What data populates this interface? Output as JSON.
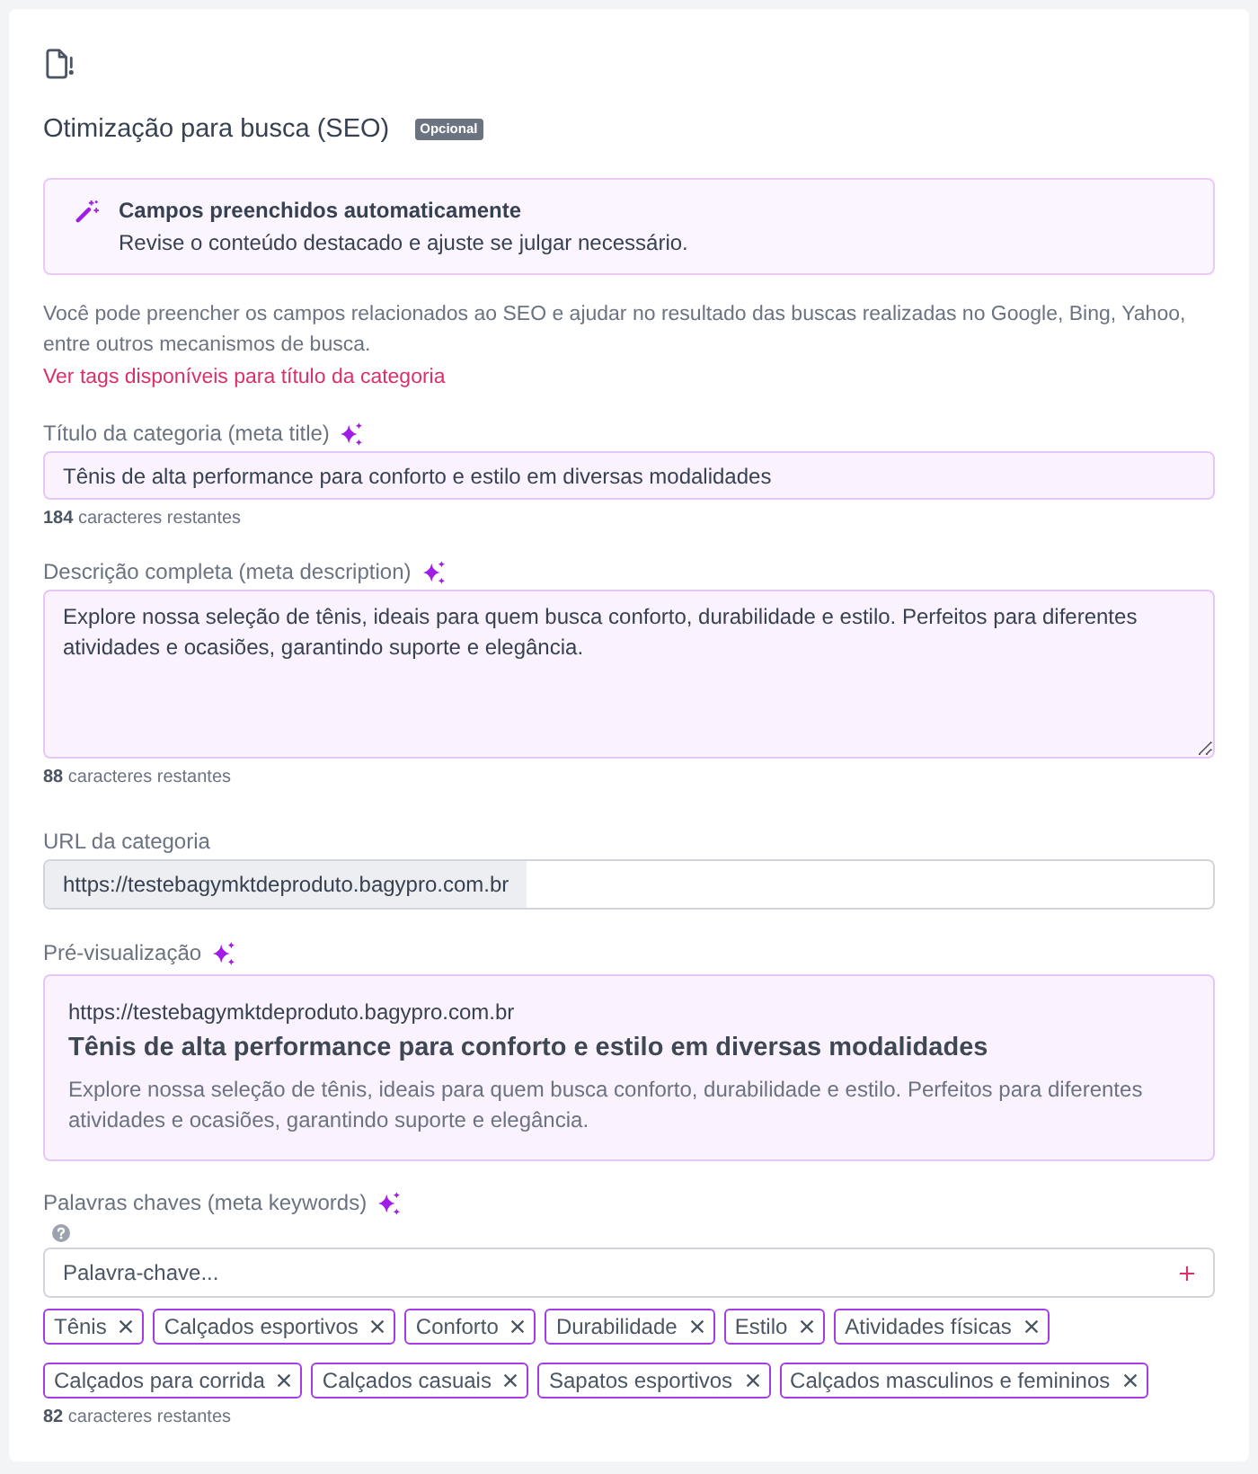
{
  "section": {
    "title": "Otimização para busca (SEO)",
    "badge": "Opcional"
  },
  "notice": {
    "title": "Campos preenchidos automaticamente",
    "message": "Revise o conteúdo destacado e ajuste se julgar necessário."
  },
  "intro": {
    "text": "Você pode preencher os campos relacionados ao SEO e ajudar no resultado das buscas realizadas no Google, Bing, Yahoo, entre outros mecanismos de busca.",
    "link": "Ver tags disponíveis para título da categoria"
  },
  "fields": [
    {
      "kind": "input",
      "label": "Título da categoria (meta title)",
      "auto_filled": true,
      "value": "Tênis de alta performance para conforto e estilo em diversas modalidades",
      "counter": "**184** caracteres restantes"
    },
    {
      "kind": "textarea",
      "label": "Descrição completa (meta description)",
      "auto_filled": true,
      "value": "Explore nossa seleção de tênis, ideais para quem busca conforto, durabilidade e estilo. Perfeitos para diferentes atividades e ocasiões, garantindo suporte e elegância.",
      "counter": "**88** caracteres restantes"
    },
    {
      "kind": "url",
      "label": "URL da categoria",
      "auto_filled": false,
      "prefix": "https://testebagymktdeproduto.bagypro.com.br"
    },
    {
      "kind": "preview",
      "label": "Pré-visualização",
      "auto_filled": true,
      "url": "https://testebagymktdeproduto.bagypro.com.br",
      "title": "Tênis de alta performance para conforto e estilo em diversas modalidades",
      "description": "Explore nossa seleção de tênis, ideais para quem busca conforto, durabilidade e estilo. Perfeitos para diferentes atividades e ocasiões, garantindo suporte e elegância."
    },
    {
      "kind": "keywords",
      "label": "Palavras chaves (meta keywords)",
      "auto_filled": true,
      "placeholder": "Palavra-chave...",
      "tags": [
        "Tênis",
        "Calçados esportivos",
        "Conforto",
        "Durabilidade",
        "Estilo",
        "Atividades físicas",
        "Calçados para corrida",
        "Calçados casuais",
        "Sapatos esportivos",
        "Calçados masculinos e femininos"
      ],
      "counter": "**82** caracteres restantes"
    }
  ]
}
